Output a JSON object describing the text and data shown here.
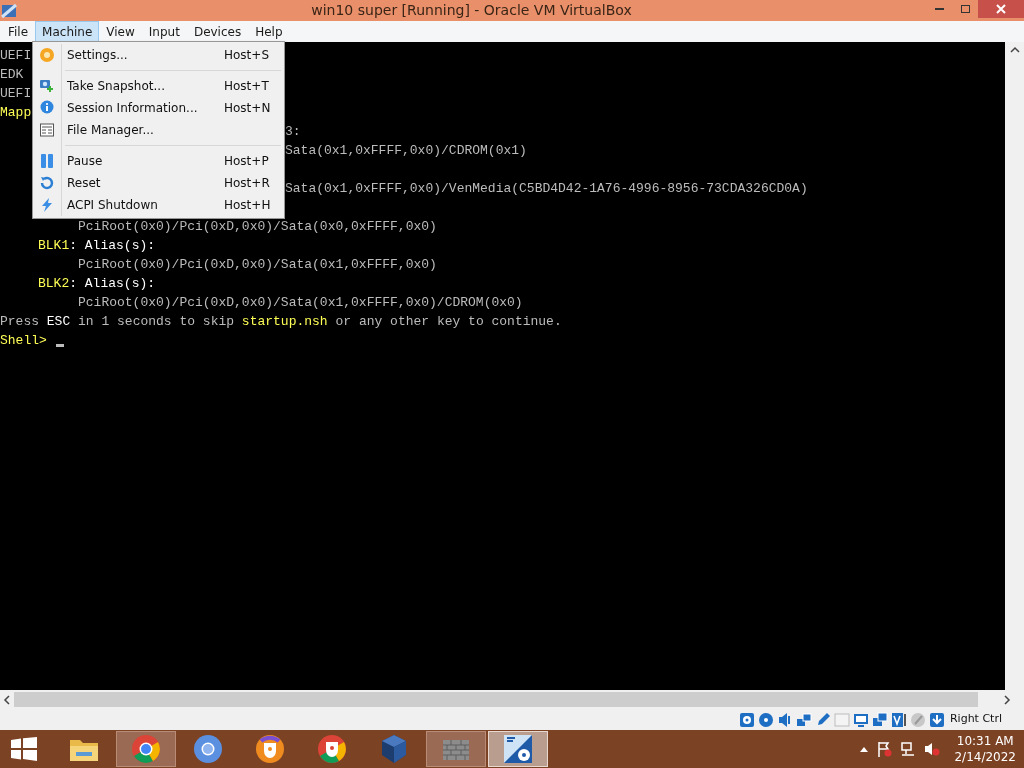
{
  "window": {
    "title": "win10 super [Running] - Oracle VM VirtualBox"
  },
  "menu_bar": [
    {
      "label": "File",
      "selected": false
    },
    {
      "label": "Machine",
      "selected": true
    },
    {
      "label": "View",
      "selected": false
    },
    {
      "label": "Input",
      "selected": false
    },
    {
      "label": "Devices",
      "selected": false
    },
    {
      "label": "Help",
      "selected": false
    }
  ],
  "machine_menu": {
    "groups": [
      [
        {
          "kind": "settings",
          "label": "Settings...",
          "shortcut": "Host+S"
        }
      ],
      [
        {
          "kind": "snapshot",
          "label": "Take Snapshot...",
          "shortcut": "Host+T"
        },
        {
          "kind": "info",
          "label": "Session Information...",
          "shortcut": "Host+N"
        },
        {
          "kind": "files",
          "label": "File Manager..."
        }
      ],
      [
        {
          "kind": "pause",
          "label": "Pause",
          "shortcut": "Host+P"
        },
        {
          "kind": "reset",
          "label": "Reset",
          "shortcut": "Host+R"
        },
        {
          "kind": "shutdown",
          "label": "ACPI Shutdown",
          "shortcut": "Host+H"
        }
      ]
    ]
  },
  "console": {
    "lines": [
      {
        "kind": "plain",
        "segments": [
          {
            "text": "UEFI",
            "color": "#bcbcbc"
          }
        ]
      },
      {
        "kind": "plain",
        "segments": [
          {
            "text": "EDK",
            "color": "#bcbcbc"
          }
        ]
      },
      {
        "kind": "plain",
        "segments": [
          {
            "text": "UEFI",
            "color": "#bcbcbc"
          }
        ]
      },
      {
        "kind": "plain",
        "segments": [
          {
            "text": "Mapp",
            "color": "#ffff55"
          }
        ]
      },
      {
        "kind": "behind_menu",
        "segments": [
          {
            "text": "3:",
            "color": "#bcbcbc"
          }
        ]
      },
      {
        "kind": "behind_menu",
        "segments": [
          {
            "text": "Sata(0x1,0xFFFF,0x0)/CDROM(0x1)",
            "color": "#bcbcbc"
          }
        ]
      },
      {
        "kind": "covered"
      },
      {
        "kind": "behind_menu",
        "segments": [
          {
            "text": "Sata(0x1,0xFFFF,0x0)/VenMedia(C5BD4D42-1A76-4996-8956-73CDA326CD0A)",
            "color": "#bcbcbc"
          }
        ]
      },
      {
        "kind": "covered"
      },
      {
        "kind": "path",
        "segments": [
          {
            "text": "PciRoot(0x0)/Pci(0xD,0x0)/Sata(0x0,0xFFFF,0x0)",
            "color": "#bcbcbc"
          }
        ]
      },
      {
        "kind": "device",
        "segments": [
          {
            "text": "BLK1",
            "color": "#ffff55"
          },
          {
            "text": ": Alias(s):",
            "color": "#ffffff"
          }
        ]
      },
      {
        "kind": "path",
        "segments": [
          {
            "text": "PciRoot(0x0)/Pci(0xD,0x0)/Sata(0x1,0xFFFF,0x0)",
            "color": "#bcbcbc"
          }
        ]
      },
      {
        "kind": "device",
        "segments": [
          {
            "text": "BLK2",
            "color": "#ffff55"
          },
          {
            "text": ": Alias(s):",
            "color": "#ffffff"
          }
        ]
      },
      {
        "kind": "path",
        "segments": [
          {
            "text": "PciRoot(0x0)/Pci(0xD,0x0)/Sata(0x1,0xFFFF,0x0)/CDROM(0x0)",
            "color": "#bcbcbc"
          }
        ]
      },
      {
        "kind": "plain",
        "segments": [
          {
            "text": "Press ",
            "color": "#bcbcbc"
          },
          {
            "text": "ESC",
            "color": "#ffffff"
          },
          {
            "text": " in 1 seconds to skip ",
            "color": "#bcbcbc"
          },
          {
            "text": "startup.nsh",
            "color": "#ffff55"
          },
          {
            "text": " or any other key to continue.",
            "color": "#bcbcbc"
          }
        ]
      },
      {
        "kind": "prompt",
        "segments": [
          {
            "text": "Shell>",
            "color": "#ffff55"
          }
        ]
      }
    ]
  },
  "status_bar": {
    "host_key": "Right Ctrl"
  },
  "taskbar": {
    "apps": [
      {
        "kind": "folder",
        "running": false,
        "selected": false
      },
      {
        "kind": "chrome",
        "running": true,
        "selected": false
      },
      {
        "kind": "chromium",
        "running": false,
        "selected": false
      },
      {
        "kind": "shield-orange",
        "running": false,
        "selected": false
      },
      {
        "kind": "shield-chrome",
        "running": false,
        "selected": false
      },
      {
        "kind": "cube",
        "running": false,
        "selected": false
      },
      {
        "kind": "wall",
        "running": true,
        "selected": false
      },
      {
        "kind": "win10",
        "running": true,
        "selected": true
      }
    ],
    "time": "10:31 AM",
    "date": "2/14/2022"
  }
}
